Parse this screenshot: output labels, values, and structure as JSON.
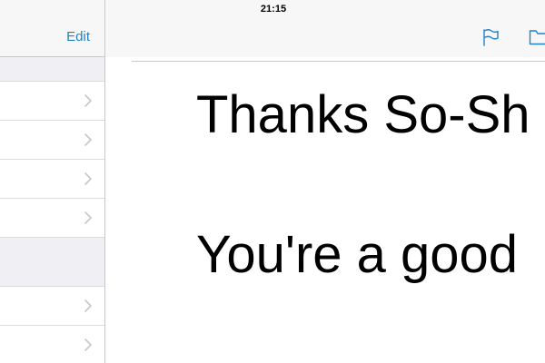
{
  "status_bar": {
    "time": "21:15"
  },
  "sidebar": {
    "edit_label": "Edit",
    "rows": [
      {
        "label": ""
      },
      {
        "label": ""
      },
      {
        "label": ""
      },
      {
        "label": ""
      },
      {
        "label": ""
      },
      {
        "label": ""
      }
    ]
  },
  "toolbar": {
    "icons": [
      "flag-icon",
      "folder-icon"
    ]
  },
  "message": {
    "line1": "Thanks So-Sh",
    "line2": "You're a good"
  },
  "colors": {
    "accent": "#1f82c8",
    "separator": "#c8c7cc",
    "section_bg": "#efeff4",
    "bar_bg": "#f7f7f7"
  }
}
